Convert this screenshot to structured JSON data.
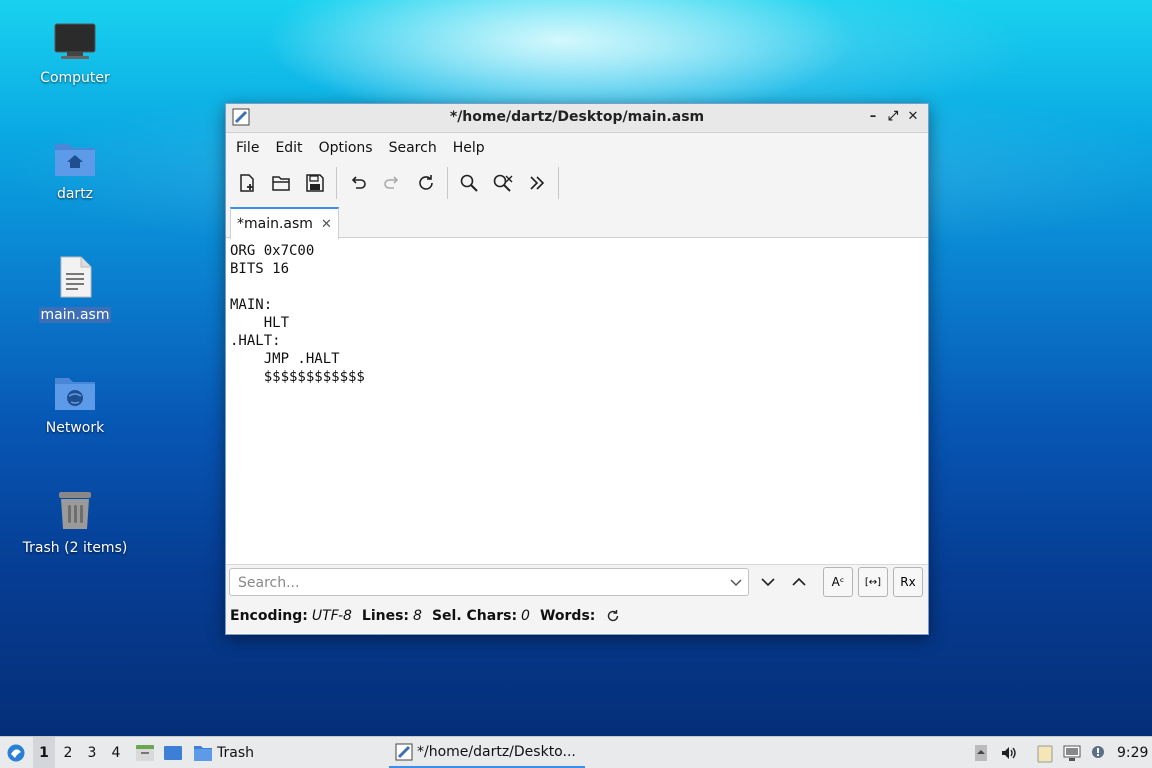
{
  "desktop": {
    "icons": [
      {
        "label": "Computer"
      },
      {
        "label": "dartz"
      },
      {
        "label": "main.asm"
      },
      {
        "label": "Network"
      },
      {
        "label": "Trash (2 items)"
      }
    ]
  },
  "window": {
    "title": "*/home/dartz/Desktop/main.asm",
    "controls": {
      "minimize": "–",
      "maximize": "⤢",
      "close": "✕"
    },
    "menu": [
      "File",
      "Edit",
      "Options",
      "Search",
      "Help"
    ],
    "toolbar_icons": [
      "new-document-icon",
      "open-folder-icon",
      "save-icon",
      "undo-icon",
      "redo-icon",
      "reload-icon",
      "find-icon",
      "find-replace-icon",
      "more-icon"
    ],
    "tab": {
      "label": "*main.asm",
      "close": "✕"
    },
    "editor_text": "ORG 0x7C00\nBITS 16\n\nMAIN:\n    HLT\n.HALT:\n    JMP .HALT\n    $$$$$$$$$$$$",
    "search": {
      "placeholder": "Search..."
    },
    "search_buttons": {
      "case": "Aᶜ",
      "whole_word": "[↔]",
      "regex": "Rx"
    },
    "status": {
      "encoding_label": "Encoding:",
      "encoding_value": "UTF-8",
      "lines_label": "Lines:",
      "lines_value": "8",
      "sel_label": "Sel. Chars:",
      "sel_value": "0",
      "words_label": "Words:"
    }
  },
  "taskbar": {
    "workspaces": [
      "1",
      "2",
      "3",
      "4"
    ],
    "trash_label": "Trash",
    "active_task": "*/home/dartz/Deskto...",
    "clock": "9:29"
  },
  "colors": {
    "accent": "#3d8ee6",
    "selection": "#3d6fb6"
  }
}
